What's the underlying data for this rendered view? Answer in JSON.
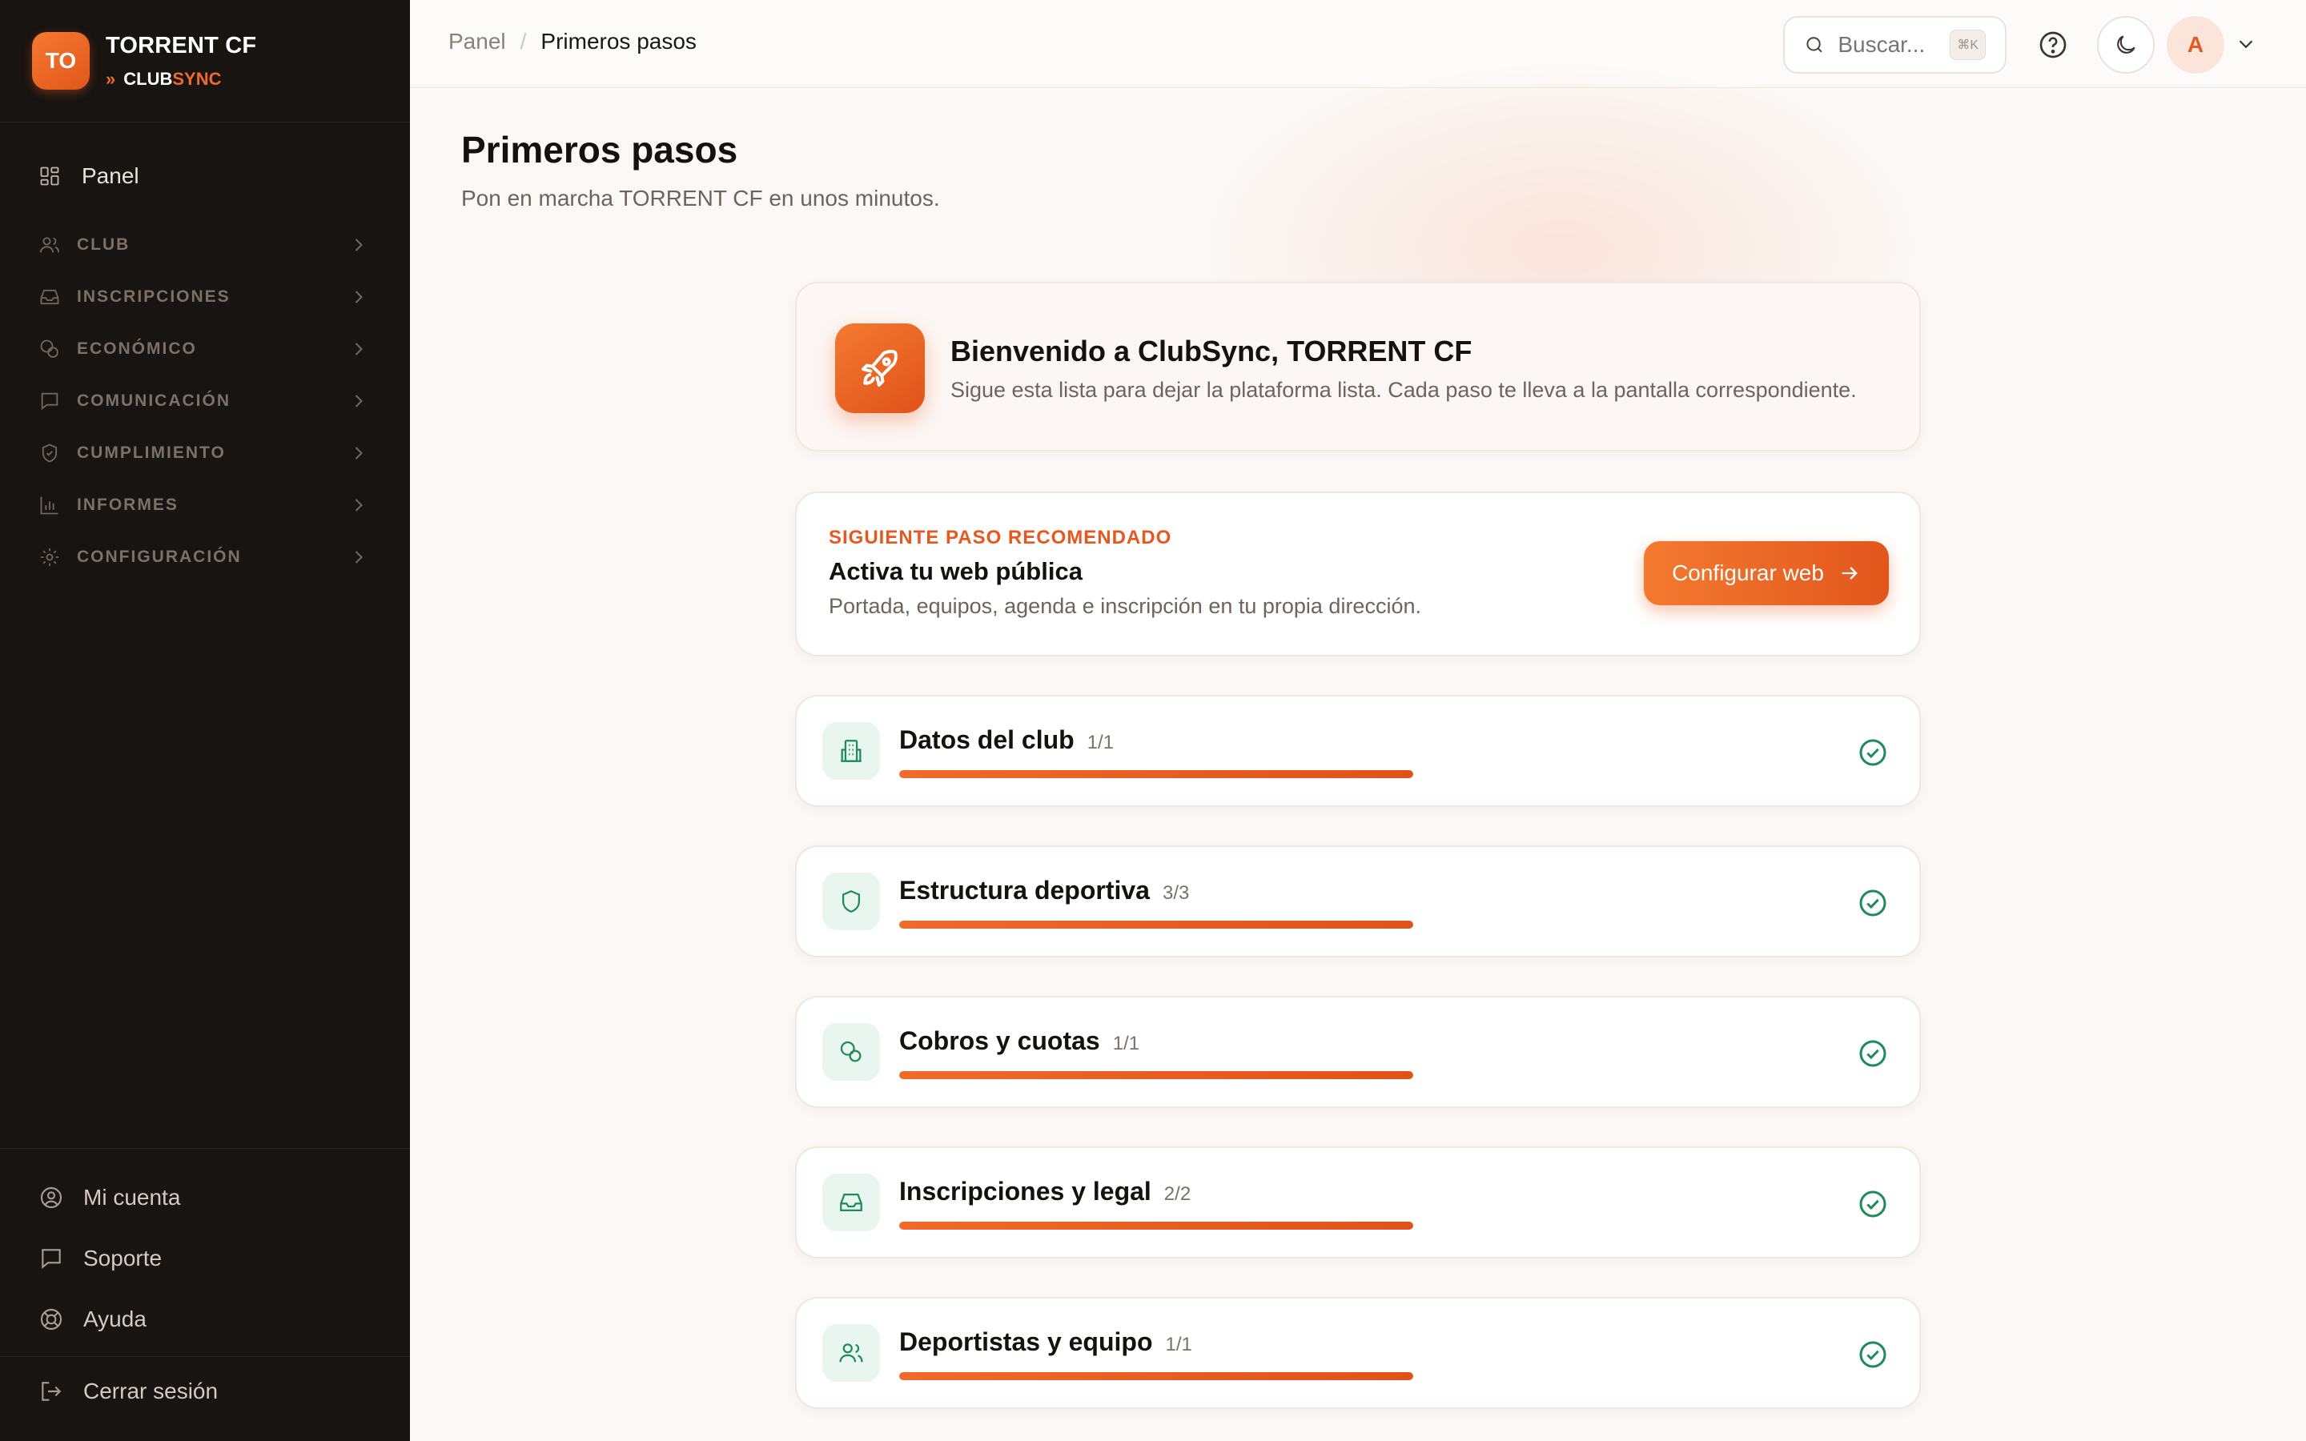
{
  "brand": {
    "logo_text": "TO",
    "club_name": "TORRENT CF",
    "product_prefix": "CLUB",
    "product_suffix": "SYNC"
  },
  "sidebar": {
    "panel_label": "Panel",
    "groups": [
      {
        "label": "CLUB",
        "icon": "users-icon"
      },
      {
        "label": "INSCRIPCIONES",
        "icon": "inbox-icon"
      },
      {
        "label": "ECONÓMICO",
        "icon": "coins-icon"
      },
      {
        "label": "COMUNICACIÓN",
        "icon": "message-icon"
      },
      {
        "label": "CUMPLIMIENTO",
        "icon": "shield-icon"
      },
      {
        "label": "INFORMES",
        "icon": "bar-chart-icon"
      },
      {
        "label": "CONFIGURACIÓN",
        "icon": "gear-icon"
      }
    ],
    "footer": {
      "account": "Mi cuenta",
      "support": "Soporte",
      "help": "Ayuda",
      "logout": "Cerrar sesión"
    }
  },
  "topbar": {
    "breadcrumb": [
      "Panel",
      "Primeros pasos"
    ],
    "search_placeholder": "Buscar...",
    "search_shortcut": "⌘K",
    "avatar_initial": "A"
  },
  "page": {
    "title": "Primeros pasos",
    "subtitle": "Pon en marcha TORRENT CF en unos minutos."
  },
  "welcome": {
    "title": "Bienvenido a ClubSync, TORRENT CF",
    "description": "Sigue esta lista para dejar la plataforma lista. Cada paso te lleva a la pantalla correspondiente."
  },
  "next_step": {
    "kicker": "SIGUIENTE PASO RECOMENDADO",
    "title": "Activa tu web pública",
    "description": "Portada, equipos, agenda e inscripción en tu propia dirección.",
    "button_label": "Configurar web"
  },
  "steps": [
    {
      "title": "Datos del club",
      "count": "1/1",
      "progress": 1.0,
      "icon": "building-icon",
      "complete": true
    },
    {
      "title": "Estructura deportiva",
      "count": "3/3",
      "progress": 1.0,
      "icon": "shield-icon",
      "complete": true
    },
    {
      "title": "Cobros y cuotas",
      "count": "1/1",
      "progress": 1.0,
      "icon": "coins-icon",
      "complete": true
    },
    {
      "title": "Inscripciones y legal",
      "count": "2/2",
      "progress": 1.0,
      "icon": "inbox-icon",
      "complete": true
    },
    {
      "title": "Deportistas y equipo",
      "count": "1/1",
      "progress": 1.0,
      "icon": "users-icon",
      "complete": true
    }
  ],
  "colors": {
    "accent": "#e8571e",
    "sidebar_bg": "#181411",
    "success": "#1f8a5b"
  }
}
